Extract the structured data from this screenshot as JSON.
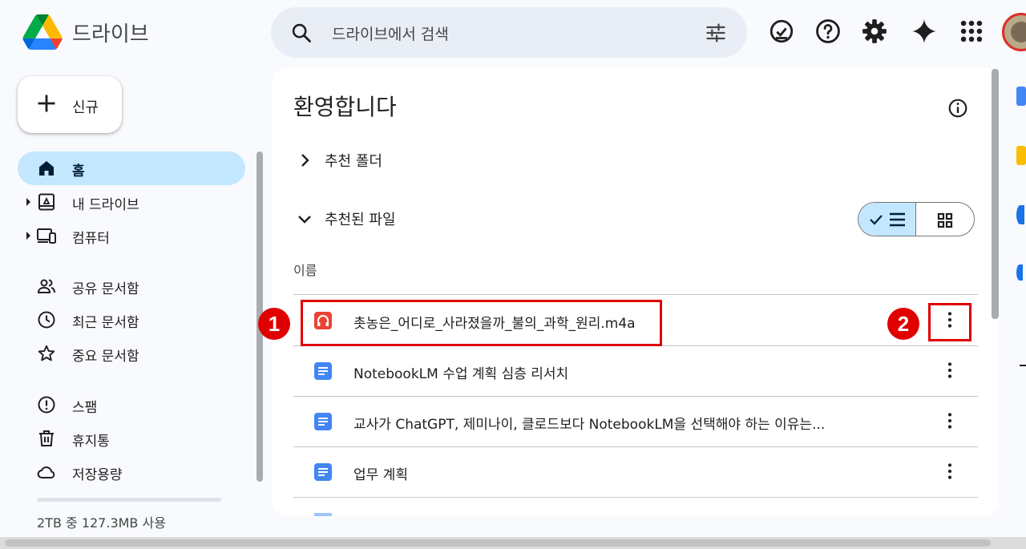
{
  "header": {
    "brand": "드라이브",
    "search_placeholder": "드라이브에서 검색"
  },
  "sidebar": {
    "new_label": "신규",
    "items": [
      {
        "label": "홈"
      },
      {
        "label": "내 드라이브"
      },
      {
        "label": "컴퓨터"
      },
      {
        "label": "공유 문서함"
      },
      {
        "label": "최근 문서함"
      },
      {
        "label": "중요 문서함"
      },
      {
        "label": "스팸"
      },
      {
        "label": "휴지통"
      },
      {
        "label": "저장용량"
      }
    ],
    "storage_text": "2TB 중 127.3MB 사용"
  },
  "main": {
    "welcome": "환영합니다",
    "section_folders": "추천 폴더",
    "section_files": "추천된 파일",
    "column_name": "이름",
    "files": [
      {
        "name": "촛농은_어디로_사라졌을까_불의_과학_원리.m4a",
        "type": "audio"
      },
      {
        "name": "NotebookLM 수업 계획 심층 리서치",
        "type": "doc"
      },
      {
        "name": "교사가 ChatGPT, 제미나이, 클로드보다 NotebookLM을 선택해야 하는 이유는...",
        "type": "doc"
      },
      {
        "name": "업무 계획",
        "type": "doc"
      }
    ]
  },
  "annotations": {
    "badge1": "1",
    "badge2": "2",
    "color": "#e00000"
  },
  "colors": {
    "active_nav": "#c2e7ff",
    "search_bg": "#e9eef6",
    "doc_blue": "#4285f4",
    "audio_red": "#ea4335"
  }
}
